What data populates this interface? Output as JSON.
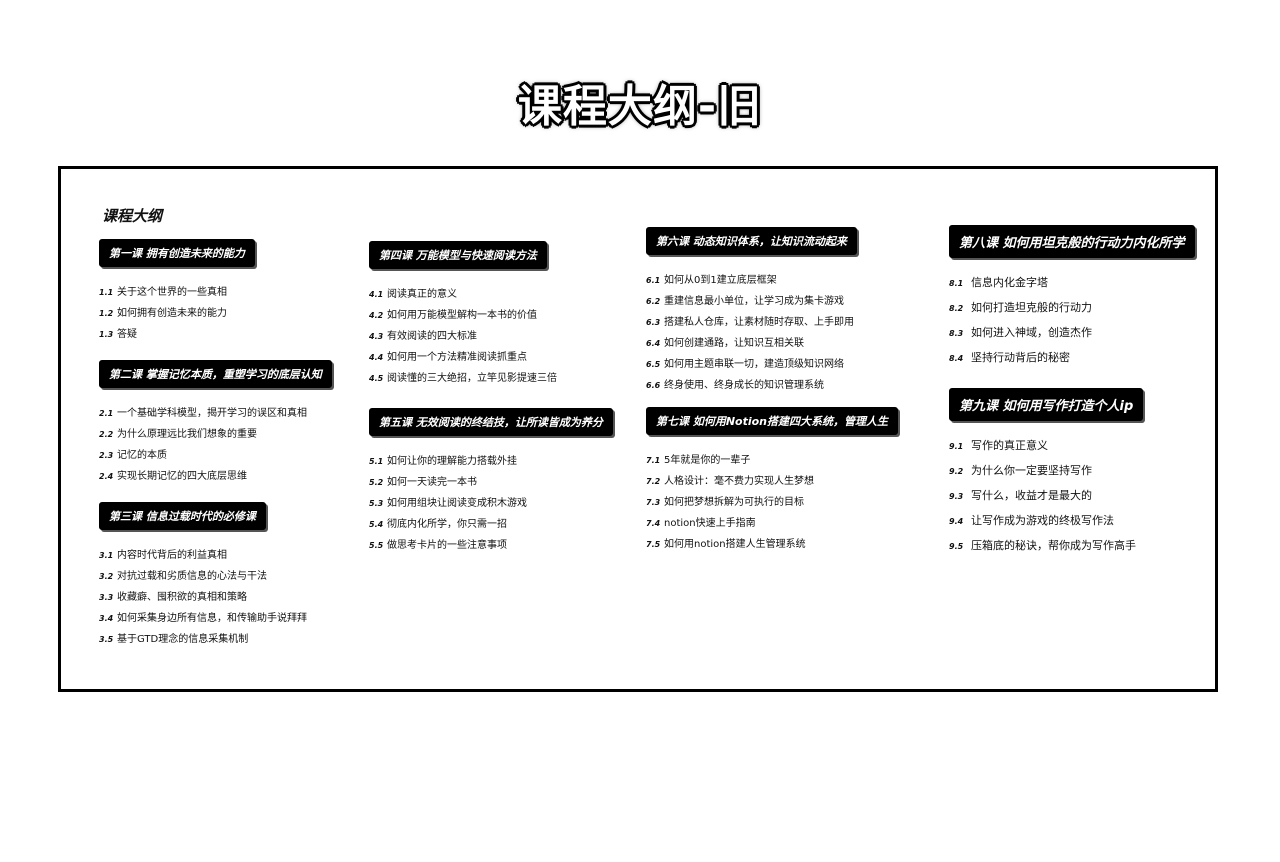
{
  "title": "课程大纲-旧",
  "panel_label": "课程大纲",
  "lessons": [
    {
      "badge": "第一课 拥有创造未来的能力",
      "items": [
        {
          "num": "1.1",
          "text": "关于这个世界的一些真相"
        },
        {
          "num": "1.2",
          "text": "如何拥有创造未来的能力"
        },
        {
          "num": "1.3",
          "text": "答疑"
        }
      ]
    },
    {
      "badge": "第二课 掌握记忆本质，重塑学习的底层认知",
      "items": [
        {
          "num": "2.1",
          "text": "一个基础学科模型，揭开学习的误区和真相"
        },
        {
          "num": "2.2",
          "text": "为什么原理远比我们想象的重要"
        },
        {
          "num": "2.3",
          "text": "记忆的本质"
        },
        {
          "num": "2.4",
          "text": "实现长期记忆的四大底层思维"
        }
      ]
    },
    {
      "badge": "第三课 信息过载时代的必修课",
      "items": [
        {
          "num": "3.1",
          "text": "内容时代背后的利益真相"
        },
        {
          "num": "3.2",
          "text": "对抗过载和劣质信息的心法与干法"
        },
        {
          "num": "3.3",
          "text": "收藏癖、囤积欲的真相和策略"
        },
        {
          "num": "3.4",
          "text": "如何采集身边所有信息，和传输助手说拜拜"
        },
        {
          "num": "3.5",
          "text": "基于GTD理念的信息采集机制"
        }
      ]
    },
    {
      "badge": "第四课 万能模型与快速阅读方法",
      "items": [
        {
          "num": "4.1",
          "text": "阅读真正的意义"
        },
        {
          "num": "4.2",
          "text": "如何用万能模型解构一本书的价值"
        },
        {
          "num": "4.3",
          "text": "有效阅读的四大标准"
        },
        {
          "num": "4.4",
          "text": "如何用一个方法精准阅读抓重点"
        },
        {
          "num": "4.5",
          "text": "阅读懂的三大绝招，立竿见影提速三倍"
        }
      ]
    },
    {
      "badge": "第五课 无效阅读的终结技，让所读皆成为养分",
      "items": [
        {
          "num": "5.1",
          "text": "如何让你的理解能力搭载外挂"
        },
        {
          "num": "5.2",
          "text": "如何一天读完一本书"
        },
        {
          "num": "5.3",
          "text": "如何用组块让阅读变成积木游戏"
        },
        {
          "num": "5.4",
          "text": "彻底内化所学，你只需一招"
        },
        {
          "num": "5.5",
          "text": "做思考卡片的一些注意事项"
        }
      ]
    },
    {
      "badge": "第六课 动态知识体系，让知识流动起来",
      "items": [
        {
          "num": "6.1",
          "text": "如何从0到1建立底层框架"
        },
        {
          "num": "6.2",
          "text": "重建信息最小单位，让学习成为集卡游戏"
        },
        {
          "num": "6.3",
          "text": "搭建私人仓库，让素材随时存取、上手即用"
        },
        {
          "num": "6.4",
          "text": "如何创建通路，让知识互相关联"
        },
        {
          "num": "6.5",
          "text": "如何用主题串联一切，建造顶级知识网络"
        },
        {
          "num": "6.6",
          "text": "终身使用、终身成长的知识管理系统"
        }
      ]
    },
    {
      "badge": "第七课 如何用Notion搭建四大系统，管理人生",
      "items": [
        {
          "num": "7.1",
          "text": "5年就是你的一辈子"
        },
        {
          "num": "7.2",
          "text": "人格设计：毫不费力实现人生梦想"
        },
        {
          "num": "7.3",
          "text": "如何把梦想拆解为可执行的目标"
        },
        {
          "num": "7.4",
          "text": "notion快速上手指南"
        },
        {
          "num": "7.5",
          "text": "如何用notion搭建人生管理系统"
        }
      ]
    },
    {
      "badge": "第八课 如何用坦克般的行动力内化所学",
      "items": [
        {
          "num": "8.1",
          "text": "信息内化金字塔"
        },
        {
          "num": "8.2",
          "text": "如何打造坦克般的行动力"
        },
        {
          "num": "8.3",
          "text": "如何进入神域，创造杰作"
        },
        {
          "num": "8.4",
          "text": "坚持行动背后的秘密"
        }
      ]
    },
    {
      "badge": "第九课 如何用写作打造个人ip",
      "items": [
        {
          "num": "9.1",
          "text": "写作的真正意义"
        },
        {
          "num": "9.2",
          "text": "为什么你一定要坚持写作"
        },
        {
          "num": "9.3",
          "text": "写什么，收益才是最大的"
        },
        {
          "num": "9.4",
          "text": "让写作成为游戏的终极写作法"
        },
        {
          "num": "9.5",
          "text": "压箱底的秘诀，帮你成为写作高手"
        }
      ]
    }
  ]
}
